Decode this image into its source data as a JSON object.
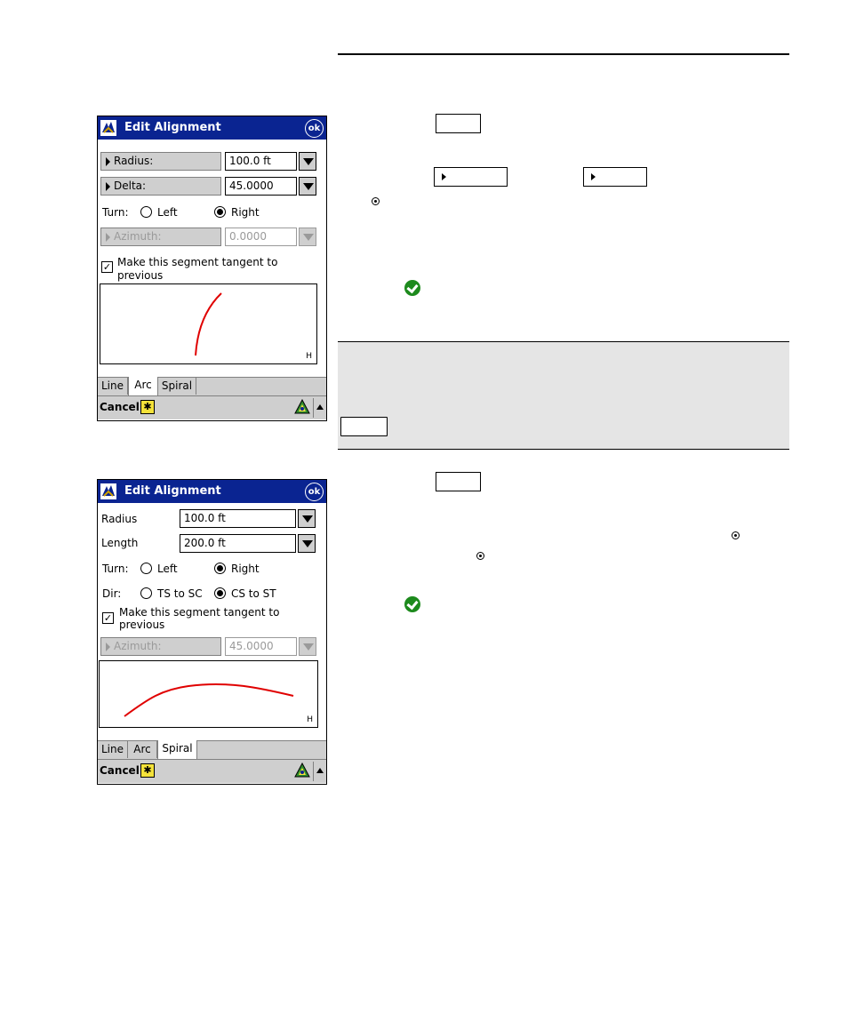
{
  "screen1": {
    "title": "Edit Alignment",
    "ok_label": "ok",
    "radius_label": "Radius:",
    "radius_value": "100.0 ft",
    "delta_label": "Delta:",
    "delta_value": "45.0000",
    "turn_label": "Turn:",
    "turn_left": "Left",
    "turn_right": "Right",
    "turn_selected": "Right",
    "azimuth_label": "Azimuth:",
    "azimuth_value": "0.0000",
    "tangent_label_1": "Make this segment tangent to",
    "tangent_label_2": "previous",
    "tangent_checked": true,
    "preview_letter": "H",
    "tabs": [
      "Line",
      "Arc",
      "Spiral"
    ],
    "active_tab": "Arc",
    "cancel_label": "Cancel",
    "curve_color": "#e00000"
  },
  "screen2": {
    "title": "Edit Alignment",
    "ok_label": "ok",
    "radius_label": "Radius",
    "radius_value": "100.0 ft",
    "length_label": "Length",
    "length_value": "200.0 ft",
    "turn_label": "Turn:",
    "turn_left": "Left",
    "turn_right": "Right",
    "turn_selected": "Right",
    "dir_label": "Dir:",
    "dir_option_1": "TS to SC",
    "dir_option_2": "CS to ST",
    "dir_selected": "CS to ST",
    "tangent_label_1": "Make this segment tangent to",
    "tangent_label_2": "previous",
    "tangent_checked": true,
    "azimuth_label": "Azimuth:",
    "azimuth_value": "45.0000",
    "preview_letter": "H",
    "tabs": [
      "Line",
      "Arc",
      "Spiral"
    ],
    "active_tab": "Spiral",
    "cancel_label": "Cancel",
    "curve_color": "#e00000"
  },
  "colors": {
    "titlebar": "#0a2491",
    "toolbar": "#cfcfcf",
    "note_background": "#e5e5e5",
    "check_icon": "#1d8a1d"
  },
  "icons": [
    "app-icon",
    "ok-icon",
    "dropdown-arrow-icon",
    "star-icon",
    "survey-triangle-icon",
    "up-arrow-icon",
    "radio-selected-icon",
    "green-check-icon"
  ]
}
